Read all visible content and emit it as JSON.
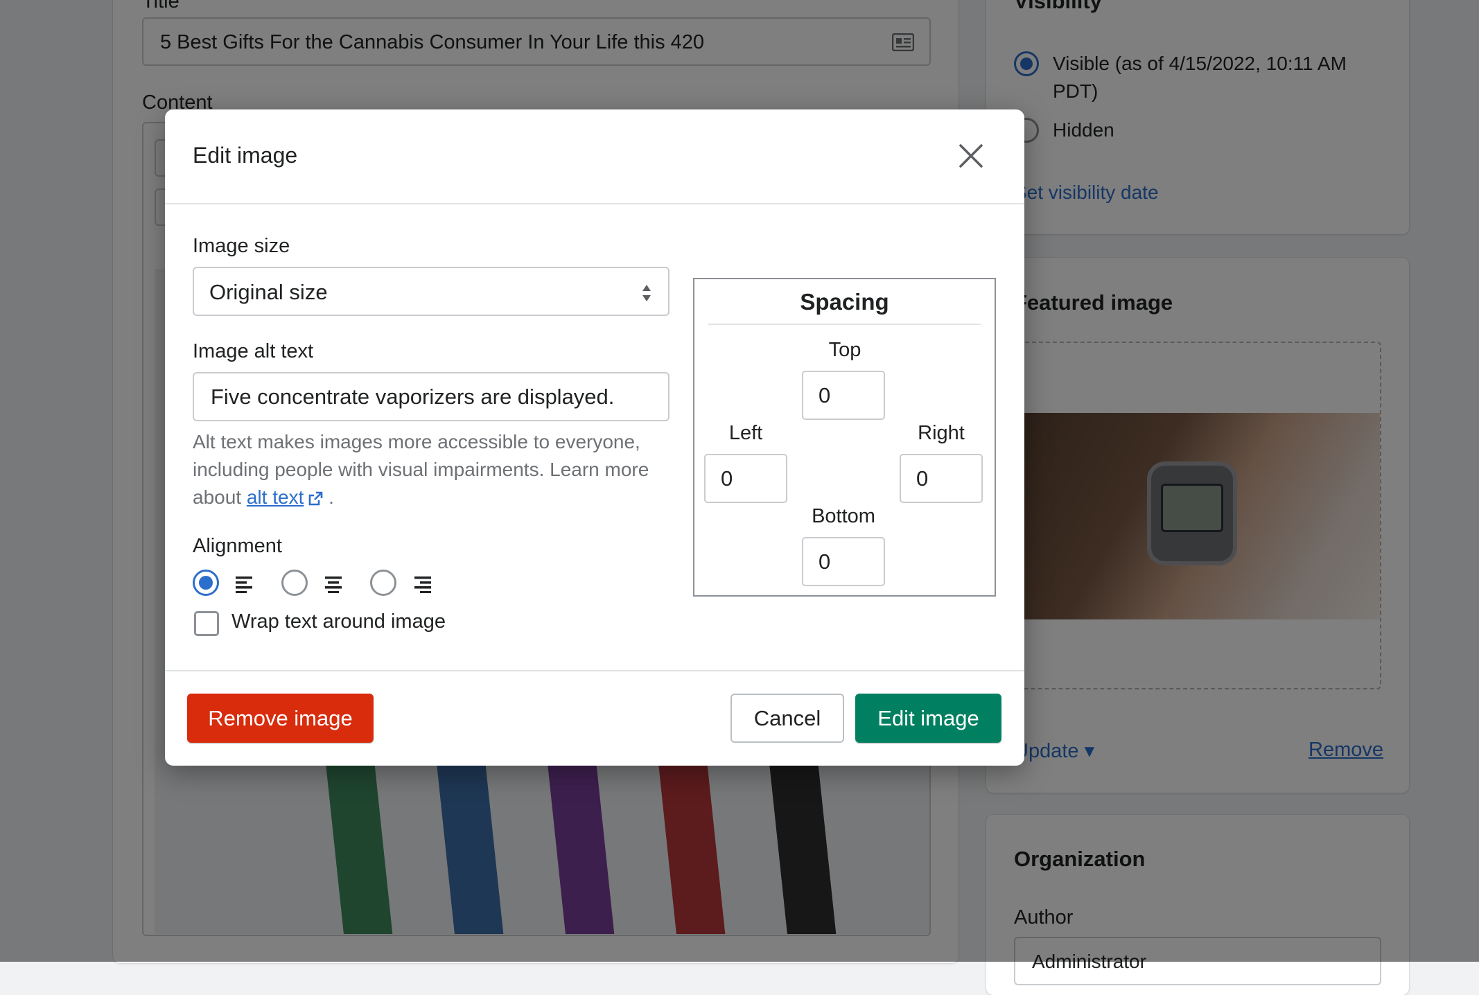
{
  "background": {
    "main": {
      "title_label": "Title",
      "title_value": "5 Best Gifts For the Cannabis Consumer In Your Life this 420",
      "content_label": "Content"
    },
    "visibility": {
      "title": "Visibility",
      "options": [
        {
          "label": "Visible (as of 4/15/2022, 10:11 AM PDT)",
          "selected": true
        },
        {
          "label": "Hidden",
          "selected": false
        }
      ],
      "set_date_link": "Set visibility date"
    },
    "featured_image": {
      "title": "Featured image",
      "update_label": "Update",
      "remove_label": "Remove"
    },
    "organization": {
      "title": "Organization",
      "author_label": "Author",
      "author_value": "Administrator"
    },
    "pen_colors": [
      "#3e8a5e",
      "#3d6fa8",
      "#7a3f9c",
      "#b8363a",
      "#2f2f2f"
    ]
  },
  "modal": {
    "title": "Edit image",
    "image_size": {
      "label": "Image size",
      "selected": "Original size"
    },
    "alt_text": {
      "label": "Image alt text",
      "value": "Five concentrate vaporizers are displayed.",
      "help_prefix": "Alt text makes images more accessible to everyone, including people with visual impairments. Learn more about ",
      "help_link": "alt text",
      "help_suffix": " ."
    },
    "alignment": {
      "label": "Alignment",
      "options": [
        "left",
        "center",
        "right"
      ],
      "selected": "left"
    },
    "wrap": {
      "label": "Wrap text around image",
      "checked": false
    },
    "spacing": {
      "title": "Spacing",
      "top_label": "Top",
      "top_value": "0",
      "left_label": "Left",
      "left_value": "0",
      "right_label": "Right",
      "right_value": "0",
      "bottom_label": "Bottom",
      "bottom_value": "0"
    },
    "buttons": {
      "remove": "Remove image",
      "cancel": "Cancel",
      "edit": "Edit image"
    }
  },
  "colors": {
    "primary_green": "#008060",
    "destructive_red": "#d82c0d",
    "link_blue": "#2c6ecb",
    "overlay": "rgba(0,0,0,0.5)"
  }
}
